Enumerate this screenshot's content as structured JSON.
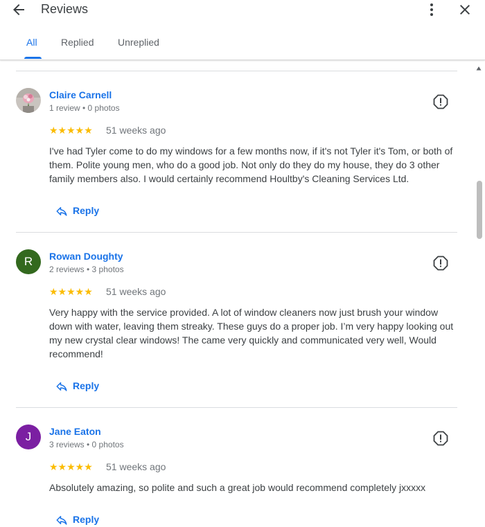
{
  "header": {
    "title": "Reviews",
    "back_icon": "arrow-back-icon",
    "more_icon": "more-vert-icon",
    "close_icon": "close-icon"
  },
  "tabs": [
    {
      "label": "All",
      "active": true
    },
    {
      "label": "Replied",
      "active": false
    },
    {
      "label": "Unreplied",
      "active": false
    }
  ],
  "colors": {
    "accent": "#1a73e8",
    "star": "#fbbc04",
    "avatar_rowan": "#33691e",
    "avatar_jane": "#7b1fa2"
  },
  "reviews": [
    {
      "name": "Claire Carnell",
      "meta": "1 review • 0 photos",
      "avatar_type": "photo",
      "stars": "★★★★★",
      "rating": 5,
      "date": "51 weeks ago",
      "text": "I've had Tyler come to do my windows for a few months now, if it's not Tyler it's Tom, or both of them. Polite young men, who do a good job. Not only do they do my house, they do 3 other family members also. I would certainly recommend Houltby's Cleaning Services Ltd.",
      "reply_label": "Reply"
    },
    {
      "name": "Rowan Doughty",
      "meta": "2 reviews • 3 photos",
      "avatar_letter": "R",
      "stars": "★★★★★",
      "rating": 5,
      "date": "51 weeks ago",
      "text": "Very happy with the service provided. A lot of window cleaners now just brush your window down with water, leaving them streaky. These guys do a proper job. I’m very happy looking out my new crystal clear windows! The came very quickly and communicated very well, Would recommend!",
      "reply_label": "Reply"
    },
    {
      "name": "Jane Eaton",
      "meta": "3 reviews • 0 photos",
      "avatar_letter": "J",
      "stars": "★★★★★",
      "rating": 5,
      "date": "51 weeks ago",
      "text": "Absolutely amazing, so polite and such a great job would recommend completely jxxxxx",
      "reply_label": "Reply"
    }
  ]
}
